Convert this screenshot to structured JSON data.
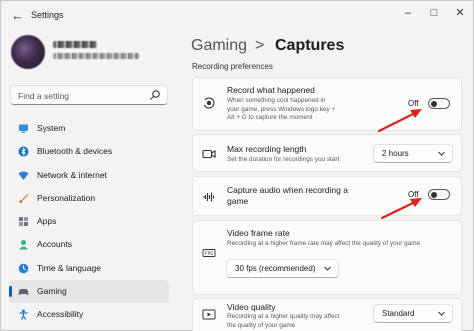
{
  "window": {
    "title": "Settings",
    "back_icon": "back-arrow-icon",
    "minimize_icon": "minimize-icon",
    "maximize_icon": "maximize-icon",
    "close_icon": "close-icon"
  },
  "search": {
    "placeholder": "Find a setting",
    "icon": "search-icon"
  },
  "sidebar": {
    "items": [
      {
        "label": "System",
        "icon": "system-icon"
      },
      {
        "label": "Bluetooth & devices",
        "icon": "bluetooth-icon"
      },
      {
        "label": "Network & internet",
        "icon": "network-icon"
      },
      {
        "label": "Personalization",
        "icon": "personalization-icon"
      },
      {
        "label": "Apps",
        "icon": "apps-icon"
      },
      {
        "label": "Accounts",
        "icon": "accounts-icon"
      },
      {
        "label": "Time & language",
        "icon": "time-language-icon"
      },
      {
        "label": "Gaming",
        "icon": "gaming-icon",
        "selected": true
      },
      {
        "label": "Accessibility",
        "icon": "accessibility-icon"
      }
    ]
  },
  "breadcrumb": {
    "parent": "Gaming",
    "separator": ">",
    "current": "Captures"
  },
  "section": {
    "heading": "Recording preferences"
  },
  "settings": {
    "record": {
      "title": "Record what happened",
      "desc_line1": "When something cool happened in",
      "desc_line2": "your game, press Windows logo key +",
      "desc_line3": "Alt + G to capture the moment",
      "toggle_label": "Off",
      "toggle_on": false,
      "icon": "record-icon"
    },
    "max_length": {
      "title": "Max recording length",
      "desc": "Set the duration for recordings you start",
      "value": "2 hours",
      "icon": "video-camera-icon"
    },
    "audio": {
      "title_line1": "Capture audio when recording a",
      "title_line2": "game",
      "toggle_label": "Off",
      "toggle_on": false,
      "icon": "audio-wave-icon"
    },
    "frame_rate": {
      "title": "Video frame rate",
      "desc": "Recording at a higher frame rate may affect the quality of your game",
      "value": "30 fps (recommended)",
      "icon": "fps-icon"
    },
    "quality": {
      "title": "Video quality",
      "desc_line1": "Recording at a higher quality may affect",
      "desc_line2": "the quality of your game",
      "value": "Standard",
      "icon": "video-quality-icon"
    }
  },
  "colors": {
    "accent": "#005fb8",
    "annotation_arrow": "#e0201a"
  }
}
